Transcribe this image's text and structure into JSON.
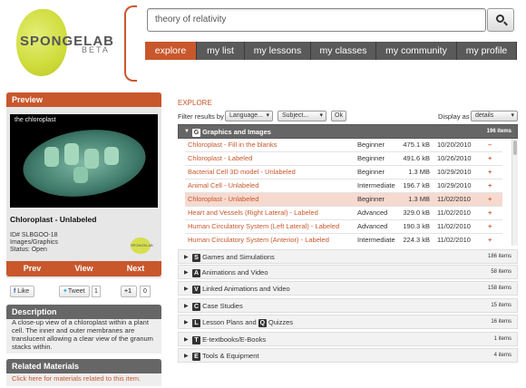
{
  "header": {
    "logo_text": "SPONGELAB",
    "logo_sub": "BETA",
    "search_value": "theory of relativity",
    "nav": [
      "explore",
      "my list",
      "my lessons",
      "my classes",
      "my community",
      "my profile"
    ],
    "accent_color": "#c8572c"
  },
  "preview": {
    "title": "Preview",
    "image_caption": "the chloroplast",
    "resource_name": "Chloroplast - Unlabeled",
    "id_line": "ID# SLBGOO-18",
    "type_line": "Images/Graphics",
    "status_line": "Status: Open",
    "small_logo_text": "SPONGELAB",
    "prev": "Prev",
    "view": "View",
    "next": "Next"
  },
  "social": {
    "like": "Like",
    "tweet": "Tweet",
    "tweet_count": "1",
    "plus": "+1",
    "plus_count": "0"
  },
  "description": {
    "title": "Description",
    "text": "A close-up view of a chloroplast within a plant cell. The inner and outer membranes are translucent allowing a clear view of the granum stacks within."
  },
  "related": {
    "title": "Related Materials",
    "link": "Click here for materials related to this item."
  },
  "explore": {
    "label": "EXPLORE",
    "filter_label": "Filter results by",
    "language": "Language...",
    "subject": "Subject...",
    "ok": "Ok",
    "display_label": "Display as",
    "display_value": "details"
  },
  "categories": [
    {
      "letter": "G",
      "title": "Graphics and Images",
      "count": "196 items",
      "open": true
    },
    {
      "letter": "S",
      "title": "Games and Simulations",
      "count": "186 items"
    },
    {
      "letter": "A",
      "title": "Animations and Video",
      "count": "58 items"
    },
    {
      "letter": "V",
      "title": "Linked Animations and Video",
      "count": "158 items"
    },
    {
      "letter": "C",
      "title": "Case Studies",
      "count": "15 items"
    },
    {
      "letter": "L",
      "title": "Lesson Plans and",
      "letter2": "Q",
      "title2": "Quizzes",
      "count": "16 items"
    },
    {
      "letter": "T",
      "title": "E-textbooks/E-Books",
      "count": "1 items"
    },
    {
      "letter": "E",
      "title": "Tools & Equipment",
      "count": "4 items"
    }
  ],
  "rows": [
    {
      "name": "Chloroplast - Fill in the blanks",
      "level": "Beginner",
      "size": "475.1 kB",
      "date": "10/20/2010",
      "action": "–"
    },
    {
      "name": "Chloroplast - Labeled",
      "level": "Beginner",
      "size": "491.6 kB",
      "date": "10/26/2010",
      "action": "+"
    },
    {
      "name": "Bacterial Cell 3D model - Unlabeled",
      "level": "Beginner",
      "size": "1.3 MB",
      "date": "10/29/2010",
      "action": "+"
    },
    {
      "name": "Animal Cell - Unlabeled",
      "level": "Intermediate",
      "size": "196.7 kB",
      "date": "10/29/2010",
      "action": "+"
    },
    {
      "name": "Chloroplast - Unlabeled",
      "level": "Beginner",
      "size": "1.3 MB",
      "date": "11/02/2010",
      "action": "+",
      "highlight": true
    },
    {
      "name": "Heart and Vessels (Right Lateral) - Labeled",
      "level": "Advanced",
      "size": "329.0 kB",
      "date": "11/02/2010",
      "action": "+"
    },
    {
      "name": "Human Circulatory System (Left Lateral) - Labeled",
      "level": "Advanced",
      "size": "190.3 kB",
      "date": "11/02/2010",
      "action": "+"
    },
    {
      "name": "Human Circulatory System (Anterior) - Labeled",
      "level": "Intermediate",
      "size": "224.3 kB",
      "date": "11/02/2010",
      "action": "+"
    },
    {
      "name": "Human Circulatory System (Anterior) - Unlabeled",
      "level": "Intermediate",
      "size": "238.0 kB",
      "date": "11/02/2010",
      "action": "+"
    }
  ]
}
